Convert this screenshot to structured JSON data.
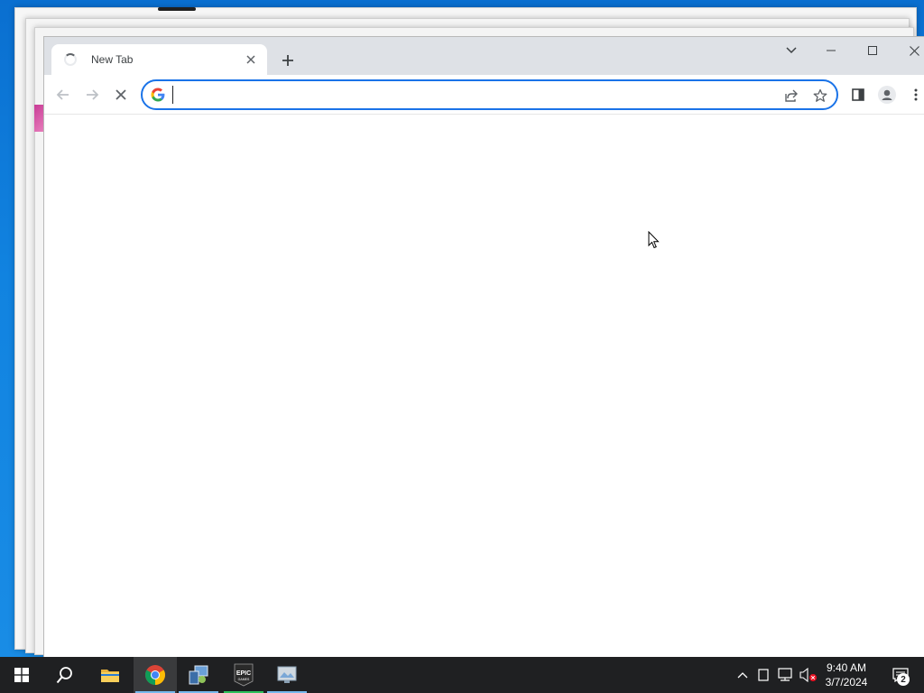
{
  "browser": {
    "tab": {
      "title": "New Tab",
      "loading": true
    },
    "omnibox": {
      "value": "",
      "focused": true
    },
    "colors": {
      "titlebar": "#dee1e6",
      "focus_ring": "#1a73e8"
    }
  },
  "taskbar": {
    "pinned": [
      {
        "name": "File Explorer",
        "icon": "folder-icon"
      },
      {
        "name": "Google Chrome",
        "icon": "chrome-icon",
        "active": true
      },
      {
        "name": "Tool",
        "icon": "tool-icon"
      },
      {
        "name": "Epic Games",
        "icon": "epic-games-icon",
        "label": "EPIC"
      },
      {
        "name": "App",
        "icon": "app-icon"
      }
    ],
    "clock": {
      "time": "9:40 AM",
      "date": "3/7/2024"
    },
    "notifications_count": "2"
  }
}
